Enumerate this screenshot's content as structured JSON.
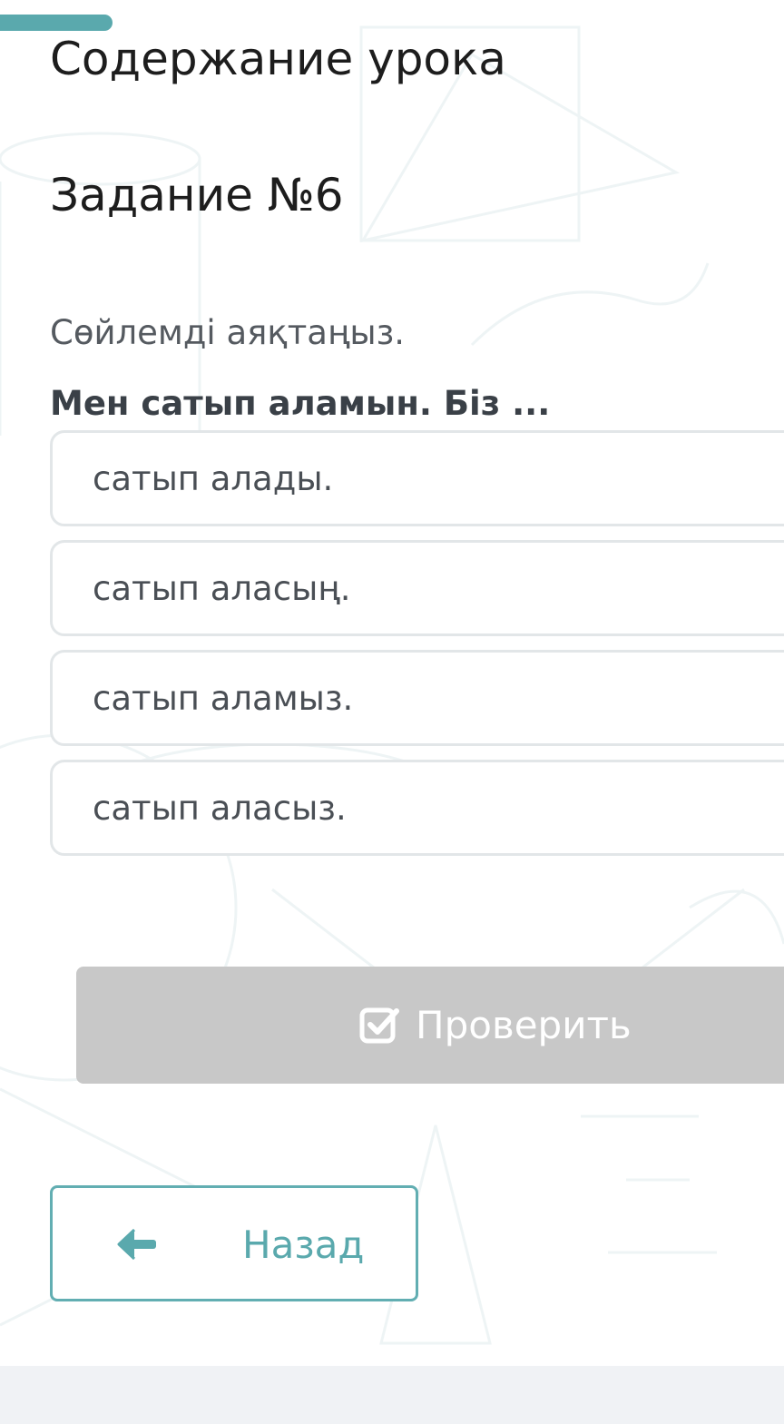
{
  "header": {
    "title": "Содержание урока"
  },
  "task": {
    "title": "Задание №6",
    "instruction": "Сөйлемді аяқтаңыз.",
    "question": "Мен сатып аламын. Біз ..."
  },
  "options": [
    {
      "label": "сатып алады."
    },
    {
      "label": "сатып аласың."
    },
    {
      "label": "сатып аламыз."
    },
    {
      "label": "сатып аласыз."
    }
  ],
  "actions": {
    "check_label": "Проверить",
    "check_icon": "checkbox-check-icon",
    "back_label": "Назад",
    "back_icon": "arrow-left-icon"
  },
  "colors": {
    "accent": "#5aa9ad",
    "check_button_bg": "#c8c8c8",
    "option_border": "#e2e6e8"
  }
}
